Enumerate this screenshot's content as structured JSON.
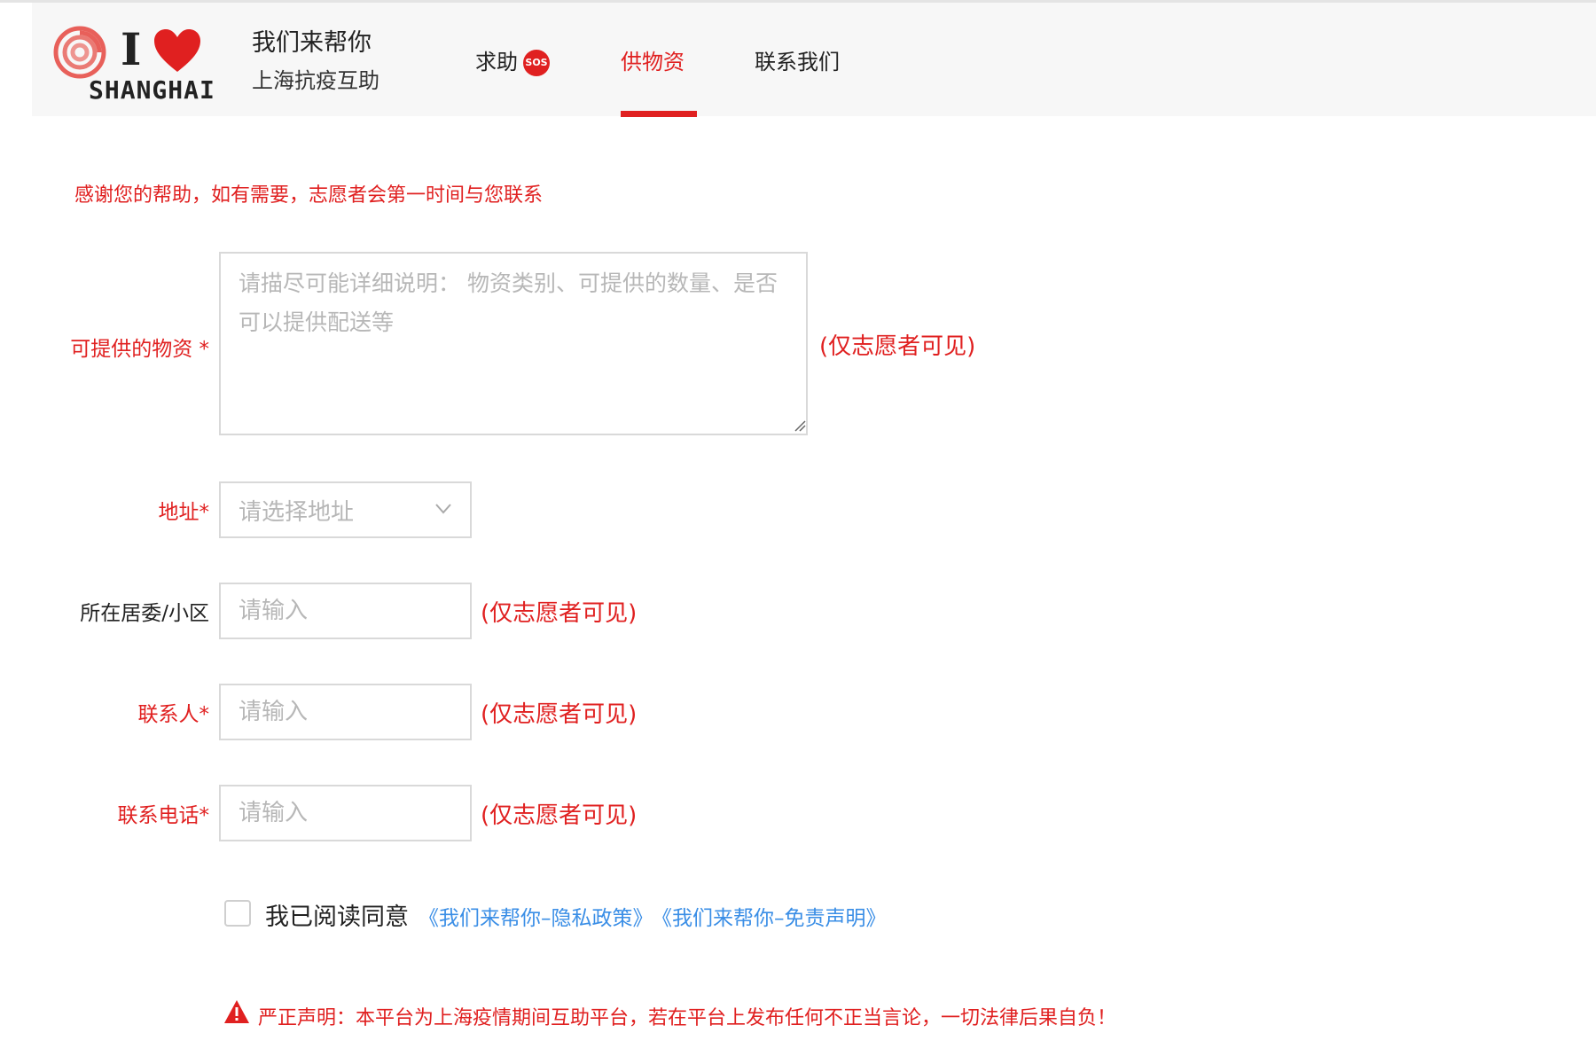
{
  "header": {
    "logo": {
      "i_letter": "I",
      "wordmark": "SHANGHAI"
    },
    "brand_title": "我们来帮你",
    "brand_subtitle": "上海抗疫互助",
    "nav": {
      "help_label": "求助",
      "sos_badge": "SOS",
      "supply_label": "供物资",
      "contact_label": "联系我们",
      "active": "供物资"
    }
  },
  "form": {
    "notice": "感谢您的帮助，如有需要，志愿者会第一时间与您联系",
    "supplies": {
      "label": "可提供的物资 *",
      "placeholder": "请描尽可能详细说明： 物资类别、可提供的数量、是否可以提供配送等",
      "hint": "(仅志愿者可见)"
    },
    "address": {
      "label": "地址*",
      "placeholder": "请选择地址"
    },
    "community": {
      "label": "所在居委/小区",
      "placeholder": "请输入",
      "hint": "(仅志愿者可见)"
    },
    "contact_person": {
      "label": "联系人*",
      "placeholder": "请输入",
      "hint": "(仅志愿者可见)"
    },
    "phone": {
      "label": "联系电话*",
      "placeholder": "请输入",
      "hint": "(仅志愿者可见)"
    },
    "agreement": {
      "checked": false,
      "text": "我已阅读同意",
      "privacy_link": "《我们来帮你–隐私政策》",
      "disclaimer_link": "《我们来帮你–免责声明》"
    },
    "warning": "严正声明：本平台为上海疫情期间互助平台，若在平台上发布任何不正当言论，一切法律后果自负！"
  },
  "colors": {
    "accent_red": "#e02020",
    "link_blue": "#3a8ee6",
    "border_gray": "#d9d9d9",
    "header_bg": "#f7f7f7"
  },
  "icons": [
    "weibo-swirl-icon",
    "heart-icon",
    "chevron-down-icon",
    "resize-handle-icon",
    "warning-triangle-icon"
  ]
}
